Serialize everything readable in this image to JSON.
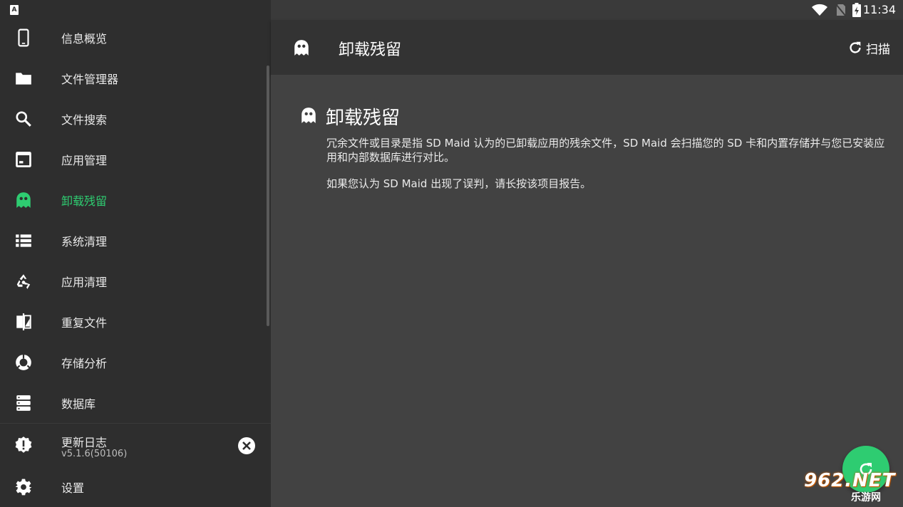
{
  "sidebar": {
    "items": [
      {
        "label": "信息概览",
        "icon": "phone-icon"
      },
      {
        "label": "文件管理器",
        "icon": "folder-icon"
      },
      {
        "label": "文件搜索",
        "icon": "search-icon"
      },
      {
        "label": "应用管理",
        "icon": "app-window-icon"
      },
      {
        "label": "卸载残留",
        "icon": "ghost-icon",
        "active": true
      },
      {
        "label": "系统清理",
        "icon": "list-icon"
      },
      {
        "label": "应用清理",
        "icon": "recycle-icon"
      },
      {
        "label": "重复文件",
        "icon": "compare-icon"
      },
      {
        "label": "存储分析",
        "icon": "pie-icon"
      },
      {
        "label": "数据库",
        "icon": "database-icon"
      }
    ],
    "changelog": {
      "label": "更新日志",
      "version": "v5.1.6(50106)"
    },
    "settings": {
      "label": "设置"
    }
  },
  "statusbar": {
    "time": "11:34"
  },
  "toolbar": {
    "title": "卸载残留",
    "scan_label": "扫描"
  },
  "content": {
    "heading": "卸载残留",
    "description": "冗余文件或目录是指 SD Maid 认为的已卸载应用的残余文件，SD Maid 会扫描您的 SD 卡和内置存储并与您已安装应用和内部数据库进行对比。",
    "note": "如果您认为 SD Maid 出现了误判，请长按该项目报告。"
  },
  "watermark": {
    "top": "962.NET",
    "bottom": "乐游网"
  },
  "colors": {
    "accent": "#2ecc71",
    "sidebar_bg": "#2e2e2e",
    "content_bg": "#424242",
    "toolbar_bg": "#333333"
  }
}
